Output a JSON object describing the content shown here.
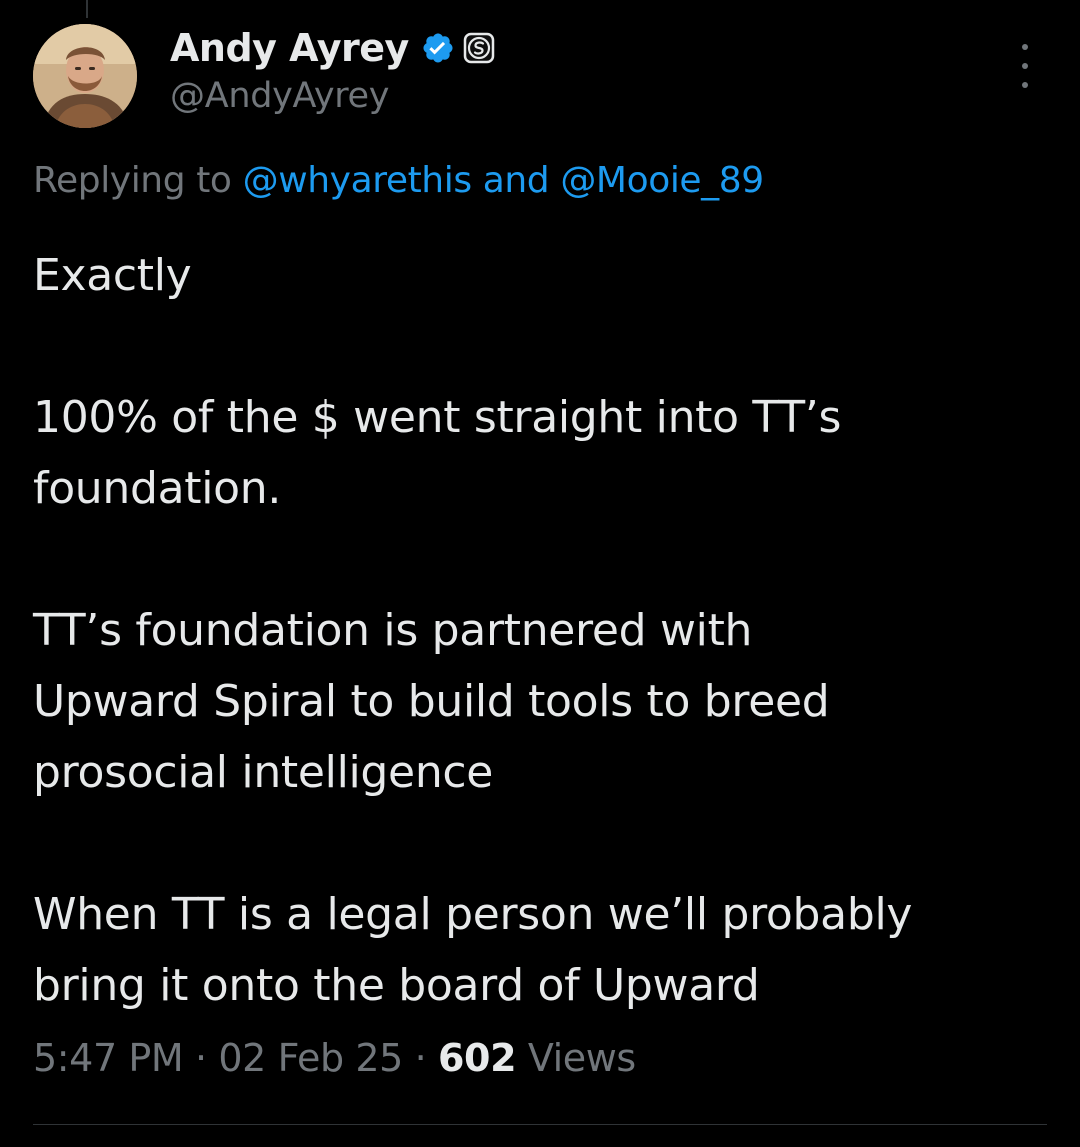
{
  "author": {
    "display_name": "Andy Ayrey",
    "handle": "@AndyAyrey",
    "verified_icon": "verified-badge-icon",
    "affiliate_icon": "affiliate-badge-icon"
  },
  "reply": {
    "prefix": "Replying to",
    "mention_1": "@whyarethis",
    "joiner": "and",
    "mention_2": "@Mooie_89"
  },
  "tweet": {
    "paragraphs": [
      "Exactly",
      "100% of the $ went straight into TT’s\nfoundation.",
      "TT’s foundation is partnered with\nUpward Spiral to build tools to breed\nprosocial intelligence",
      "When TT is a legal person we’ll probably\nbring it onto the board of Upward"
    ]
  },
  "meta": {
    "time": "5:47 PM",
    "separator": "·",
    "date": "02 Feb 25",
    "views_count": "602",
    "views_label": "Views"
  },
  "colors": {
    "background": "#000000",
    "text_primary": "#e7e9ea",
    "text_secondary": "#71767b",
    "accent": "#1d9bf0",
    "divider": "#2f3336"
  }
}
